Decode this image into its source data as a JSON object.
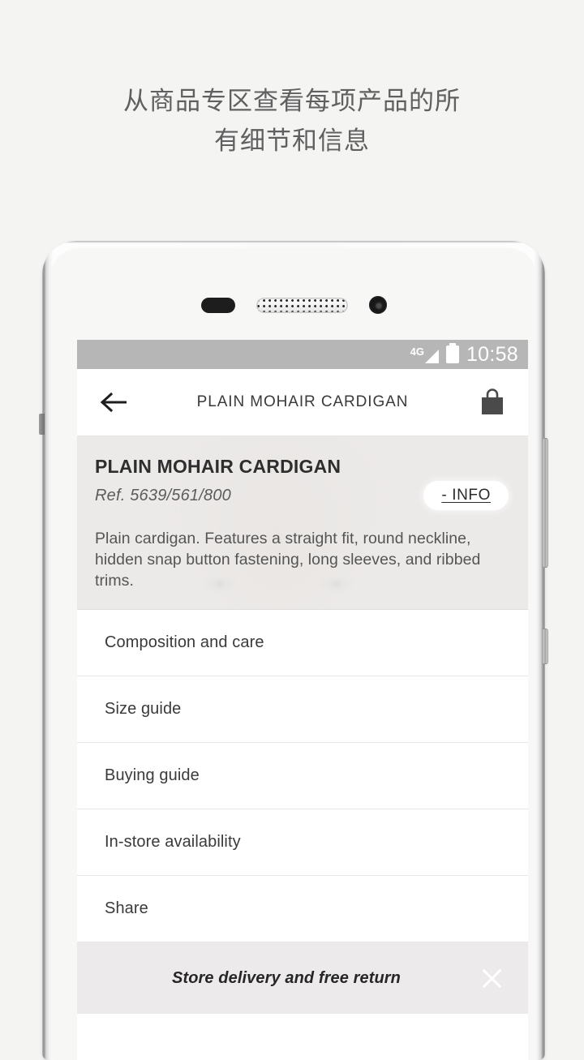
{
  "promo": {
    "headline": "从商品专区查看每项产品的所\n有细节和信息"
  },
  "status_bar": {
    "network": "4G",
    "signal_icon": "signal-triangle-icon",
    "battery_icon": "battery-full-icon",
    "time": "10:58"
  },
  "app_header": {
    "back_icon": "back-arrow-icon",
    "title": "PLAIN MOHAIR CARDIGAN",
    "bag_icon": "shopping-bag-icon"
  },
  "product": {
    "name": "PLAIN MOHAIR CARDIGAN",
    "reference": "Ref. 5639/561/800",
    "info_button": "- INFO",
    "description": "Plain cardigan. Features a straight fit, round neckline, hidden snap button fastening, long sleeves, and ribbed trims."
  },
  "menu": {
    "items": [
      {
        "label": "Composition and care"
      },
      {
        "label": "Size guide"
      },
      {
        "label": "Buying guide"
      },
      {
        "label": "In-store availability"
      },
      {
        "label": "Share"
      }
    ]
  },
  "banner": {
    "text": "Store delivery and free return",
    "close_icon": "close-x-icon"
  },
  "colors": {
    "page_background": "#f4f4f3",
    "status_bar": "#b6b6b6",
    "info_panel": "#ececea",
    "banner": "#eceaea",
    "text_primary": "#2e2e2e",
    "text_secondary": "#555555",
    "promo_text": "#606060"
  }
}
